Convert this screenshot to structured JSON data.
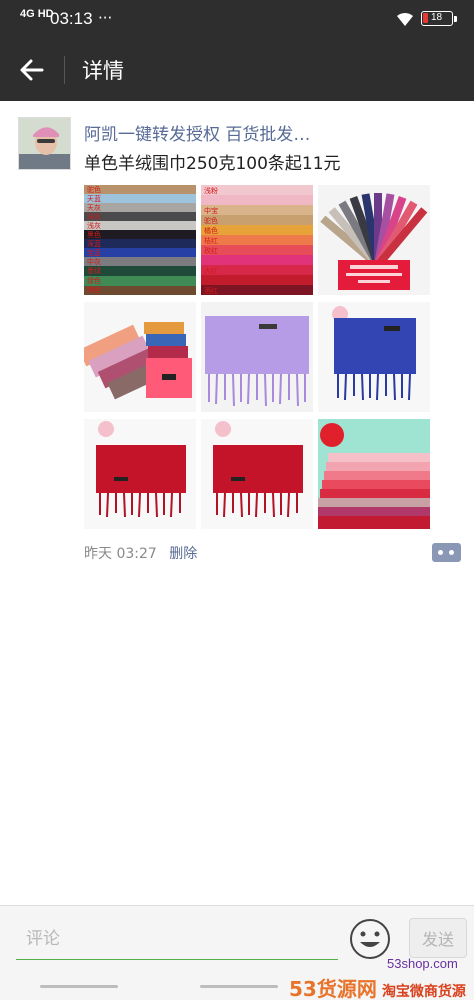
{
  "status_bar": {
    "network": "4G HD",
    "time": "03:13",
    "more": "···",
    "battery": "18",
    "battery_level": 0.18,
    "battery_color": "#e43a36"
  },
  "nav": {
    "back_icon": "back-arrow-icon",
    "title": "详情",
    "background": "#2e2e2e"
  },
  "post": {
    "author": "阿凯一键转发授权 百货批发…",
    "text": "单色羊绒围巾250克100条起11元",
    "time": "昨天 03:27",
    "delete_label": "删除",
    "link_color": "#576b95",
    "photos": [
      {
        "name": "scarf-color-chart-a",
        "labels": [
          "驼色",
          "天蓝",
          "天灰",
          "深灰",
          "浅灰",
          "黑色",
          "深蓝",
          "宝蓝",
          "中灰",
          "墨绿",
          "绿色",
          "褐色"
        ]
      },
      {
        "name": "scarf-color-chart-b",
        "labels": [
          "浅粉",
          "中宝",
          "驼色",
          "橘色",
          "桔红",
          "玫红",
          "大红",
          "酒红"
        ]
      },
      {
        "name": "scarf-fan-display"
      },
      {
        "name": "scarf-stack-assorted"
      },
      {
        "name": "scarf-lavender"
      },
      {
        "name": "scarf-royal-blue"
      },
      {
        "name": "scarf-red"
      },
      {
        "name": "scarf-red-2"
      },
      {
        "name": "scarf-pastel-stack"
      }
    ],
    "comment_icon": "comment-dots-icon"
  },
  "comment_bar": {
    "placeholder": "评论",
    "emoji_icon": "smiley-icon",
    "send_label": "发送",
    "accent": "#54b04a"
  },
  "watermark": {
    "brand": "53货源网",
    "sub": "淘宝微商货源",
    "domain": "53shop.com"
  }
}
